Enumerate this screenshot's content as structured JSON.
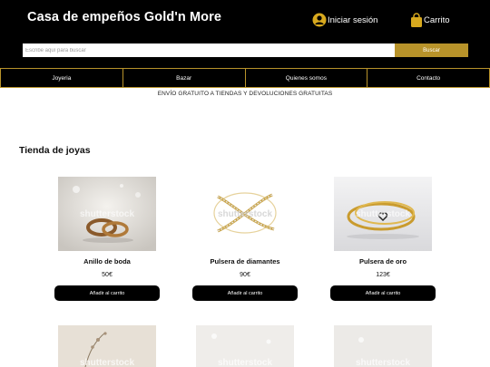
{
  "header": {
    "brand": "Casa de empeños Gold'n More",
    "login_label": "Iniciar sesión",
    "cart_label": "Carrito",
    "login_icon": "user-icon",
    "cart_icon": "shopping-bag-icon"
  },
  "search": {
    "placeholder": "Escribe aquí para buscar",
    "button_label": "Buscar"
  },
  "nav": {
    "items": [
      "Joyeria",
      "Bazar",
      "Quienes somos",
      "Contacto"
    ]
  },
  "promo": "ENVÍO GRATUITO A TIENDAS Y DEVOLUCIONES GRATUITAS",
  "section_title": "Tienda de joyas",
  "products": [
    {
      "name": "Anillo de boda",
      "price": "50€",
      "button": "Añadir al carrito"
    },
    {
      "name": "Pulsera de diamantes",
      "price": "90€",
      "button": "Añadir al carrito"
    },
    {
      "name": "Pulsera de oro",
      "price": "123€",
      "button": "Añadir al carrito"
    }
  ],
  "watermark": "shutterstock",
  "colors": {
    "header_bg": "#000000",
    "accent_gold": "#b8932a",
    "button_bg": "#000000"
  }
}
